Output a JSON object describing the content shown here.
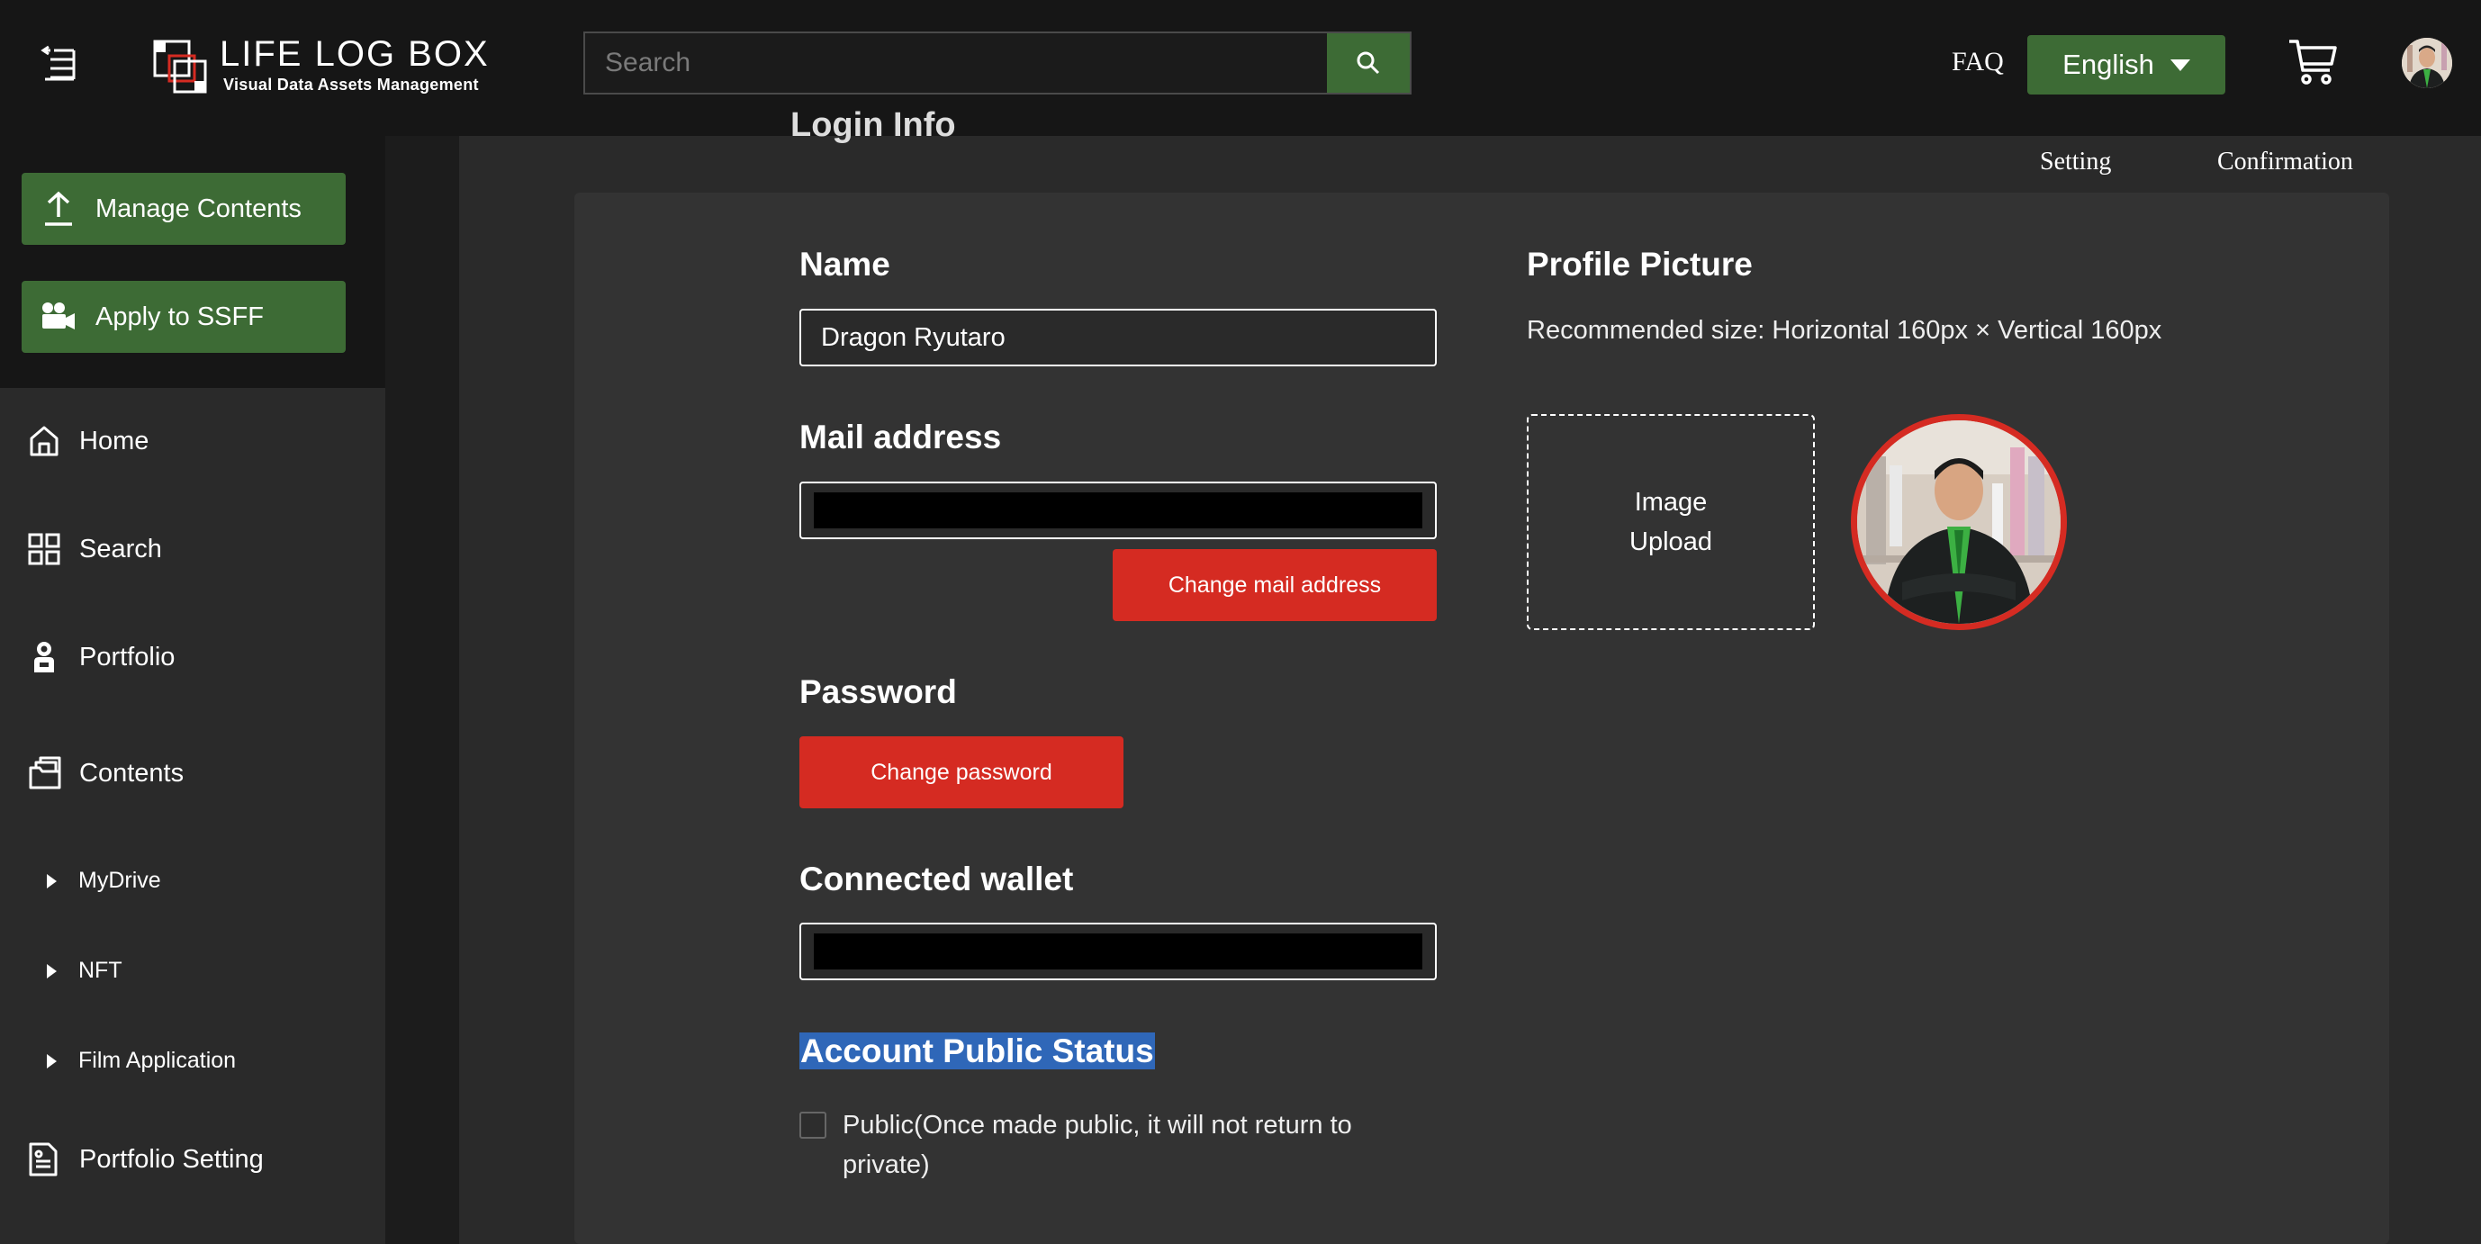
{
  "header": {
    "logo_title": "LIFE LOG BOX",
    "logo_subtitle": "Visual Data Assets Management",
    "search_placeholder": "Search",
    "faq": "FAQ",
    "language": "English",
    "icons": [
      "menu-collapse-icon",
      "search-icon",
      "cart-icon",
      "user-avatar"
    ]
  },
  "sidebar": {
    "action_buttons": [
      {
        "label": "Manage Contents",
        "icon": "upload-icon"
      },
      {
        "label": "Apply to SSFF",
        "icon": "video-camera-icon"
      }
    ],
    "nav": [
      {
        "label": "Home",
        "icon": "home-icon"
      },
      {
        "label": "Search",
        "icon": "grid-icon"
      },
      {
        "label": "Portfolio",
        "icon": "portfolio-icon"
      },
      {
        "label": "Contents",
        "icon": "folders-icon"
      }
    ],
    "sub_items": [
      "MyDrive",
      "NFT",
      "Film Application"
    ],
    "portfolio_setting": {
      "label": "Portfolio Setting",
      "icon": "document-icon"
    }
  },
  "page": {
    "cut_title": "Login Info",
    "steps": [
      "Setting",
      "Confirmation"
    ]
  },
  "form": {
    "name_label": "Name",
    "name_value": "Dragon Ryutaro",
    "mail_label": "Mail address",
    "change_mail": "Change mail address",
    "password_label": "Password",
    "change_password": "Change password",
    "wallet_label": "Connected wallet",
    "public_status_label": "Account Public Status",
    "public_checkbox_label": "Public(Once made public, it will not return to private)",
    "public_checked": false
  },
  "profile": {
    "label": "Profile Picture",
    "recommended": "Recommended size: Horizontal 160px × Vertical 160px",
    "upload_line1": "Image",
    "upload_line2": "Upload"
  },
  "colors": {
    "accent_green": "#3d6b35",
    "accent_red": "#d52b22",
    "highlight_blue": "#2f67b8"
  }
}
